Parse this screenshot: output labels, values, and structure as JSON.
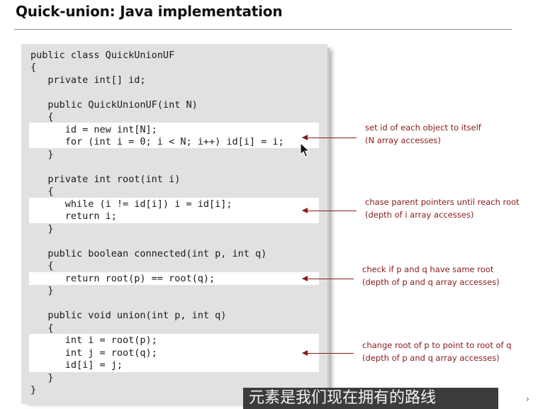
{
  "slide": {
    "title": "Quick-union:  Java implementation"
  },
  "code": {
    "lines": [
      "public class QuickUnionUF",
      "{",
      "   private int[] id;",
      "   public QuickUnionUF(int N)",
      "   {",
      "      id = new int[N];",
      "      for (int i = 0; i < N; i++) id[i] = i;",
      "   }",
      "   private int root(int i)",
      "   {",
      "      while (i != id[i]) i = id[i];",
      "      return i;",
      "   }",
      "   public boolean connected(int p, int q)",
      "   {",
      "      return root(p) == root(q);",
      "   }",
      "   public void union(int p, int q)",
      "   {",
      "      int i = root(p);",
      "      int j = root(q);",
      "      id[i] = j;",
      "   }",
      "}"
    ]
  },
  "annotations": [
    {
      "line1": "set id of each object to itself",
      "line2": "(N array accesses)"
    },
    {
      "line1": "chase parent pointers until reach root",
      "line2": "(depth of i array accesses)"
    },
    {
      "line1": "check if p and q have same root",
      "line2": "(depth of p and q array accesses)"
    },
    {
      "line1": "change root of p to point to root of q",
      "line2": "(depth of p and q array accesses)"
    }
  ],
  "subtitle": {
    "text": "元素是我们现在拥有的路线"
  },
  "colors": {
    "annotation": "#8b1a1a",
    "panel": "#e1e1e1",
    "highlight": "#ffffff"
  },
  "icons": {
    "cursor": "mouse-pointer-icon",
    "next": "chevron-right-icon"
  }
}
